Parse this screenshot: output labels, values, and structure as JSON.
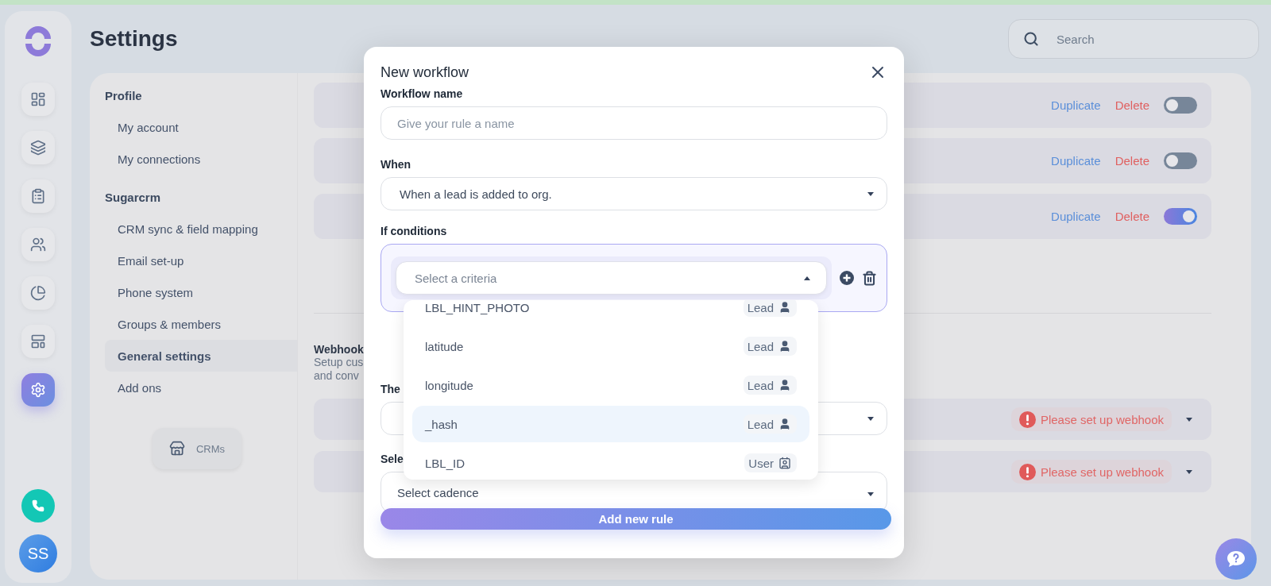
{
  "rail": {
    "items": [
      {
        "kind": "dashboard",
        "selected": false
      },
      {
        "kind": "stack",
        "selected": false
      },
      {
        "kind": "clipboard",
        "selected": false
      },
      {
        "kind": "team",
        "selected": false
      },
      {
        "kind": "pie",
        "selected": false
      },
      {
        "kind": "layout",
        "selected": false
      },
      {
        "kind": "settings",
        "selected": true
      }
    ],
    "avatar": "SS"
  },
  "page_title": "Settings",
  "search": {
    "placeholder": "Search"
  },
  "nav": {
    "sections": [
      {
        "title": "Profile",
        "items": [
          {
            "label": "My account",
            "selected": false
          },
          {
            "label": "My connections",
            "selected": false
          }
        ]
      },
      {
        "title": "Sugarcrm",
        "items": [
          {
            "label": "CRM sync & field mapping",
            "selected": false
          },
          {
            "label": "Email set-up",
            "selected": false
          },
          {
            "label": "Phone system",
            "selected": false
          },
          {
            "label": "Groups & members",
            "selected": false
          },
          {
            "label": "General settings",
            "selected": true
          },
          {
            "label": "Add ons",
            "selected": false
          }
        ]
      }
    ],
    "crm_button": "CRMs"
  },
  "workflows": [
    {
      "duplicate": "Duplicate",
      "delete": "Delete",
      "on": false
    },
    {
      "duplicate": "Duplicate",
      "delete": "Delete",
      "on": false
    },
    {
      "duplicate": "Duplicate",
      "delete": "Delete",
      "on": true
    }
  ],
  "webhook": {
    "title": "Webhook",
    "lines": [
      "Setup cus",
      "and conv"
    ],
    "rows": [
      {
        "alert": "Please set up webhook"
      },
      {
        "alert": "Please set up webhook"
      }
    ]
  },
  "modal": {
    "title": "New workflow",
    "name": {
      "label": "Workflow name",
      "placeholder": "Give your rule a name"
    },
    "when": {
      "label": "When",
      "value": "When a lead is added to org."
    },
    "conditions": {
      "label": "If conditions",
      "placeholder": "Select a criteria",
      "expanded": true,
      "options": [
        {
          "label": "LBL_HINT_PHOTO",
          "tag": "Lead",
          "kind": "lead",
          "highlighted": false
        },
        {
          "label": "latitude",
          "tag": "Lead",
          "kind": "lead",
          "highlighted": false
        },
        {
          "label": "longitude",
          "tag": "Lead",
          "kind": "lead",
          "highlighted": false
        },
        {
          "label": "_hash",
          "tag": "Lead",
          "kind": "lead",
          "highlighted": true
        },
        {
          "label": "LBL_ID",
          "tag": "User",
          "kind": "user",
          "highlighted": false
        }
      ]
    },
    "then_label": "The",
    "select_label": "Sele",
    "cadence": {
      "value": "Select cadence"
    },
    "submit": "Add new rule"
  }
}
